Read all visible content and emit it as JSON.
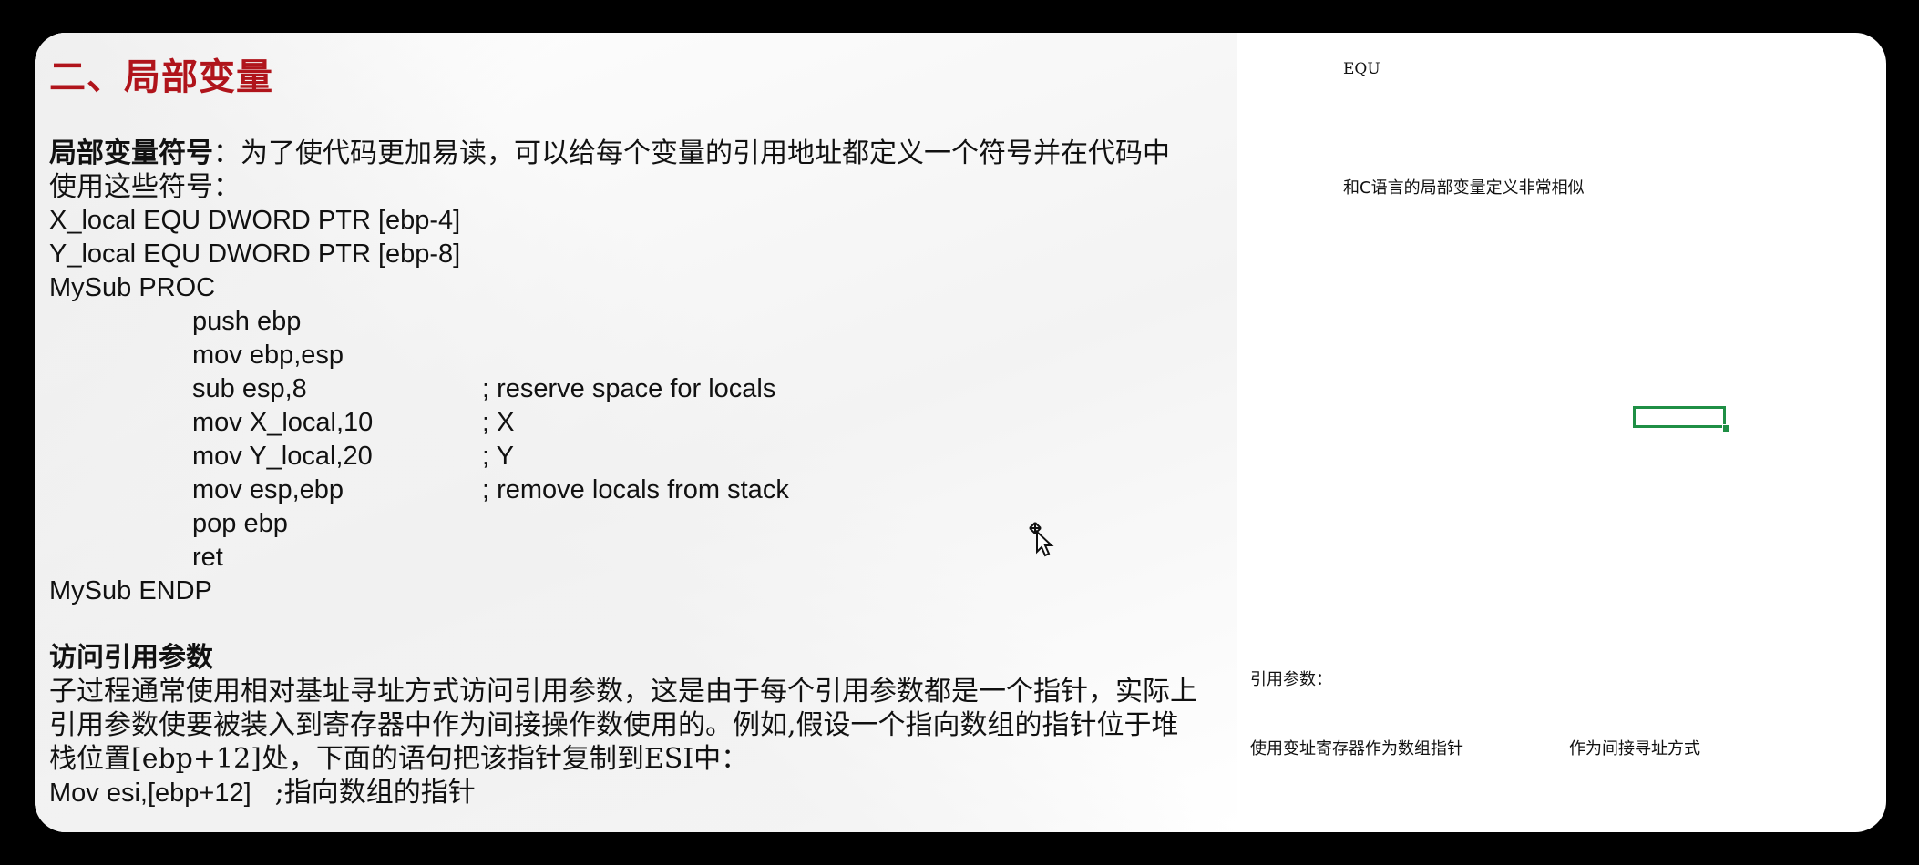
{
  "slide": {
    "title": "二、局部变量",
    "section1_heading": "局部变量符号",
    "section1_intro_line1": "：为了使代码更加易读，可以给每个变量的引用地址都定义一个符号并在代码中",
    "section1_intro_line2": "使用这些符号：",
    "code_lines": [
      "X_local EQU DWORD PTR [ebp-4]",
      "Y_local EQU DWORD PTR [ebp-8]",
      "MySub PROC",
      "push ebp",
      "mov ebp,esp",
      "sub esp,8",
      "mov X_local,10",
      "mov Y_local,20",
      "mov esp,ebp",
      "pop ebp",
      "ret",
      "MySub ENDP"
    ],
    "code_comments": [
      "; reserve space for locals",
      "; X",
      "; Y",
      "; remove locals from stack"
    ],
    "section2_heading": "访问引用参数",
    "section2_lines": [
      "子过程通常使用相对基址寻址方式访问引用参数，这是由于每个引用参数都是一个指针，实际上",
      "引用参数使要被装入到寄存器中作为间接操作数使用的。例如,假设一个指向数组的指针位于堆",
      "栈位置[ebp+12]处，下面的语句把该指针复制到ESI中："
    ],
    "section2_code": "Mov esi,[ebp+12]",
    "section2_code_comment": ";指向数组的指针"
  },
  "notes": {
    "equ_label": "EQU",
    "c_similarity": "和C语言的局部变量定义非常相似",
    "ref_params": "引用参数：",
    "array_pointer": "使用变址寄存器作为数组指针",
    "indirect_addressing": "作为间接寻址方式"
  },
  "colors": {
    "title_red": "#b0141b",
    "cell_border": "#1f8f45"
  },
  "icons": {
    "cursor": "move-cursor-icon"
  }
}
